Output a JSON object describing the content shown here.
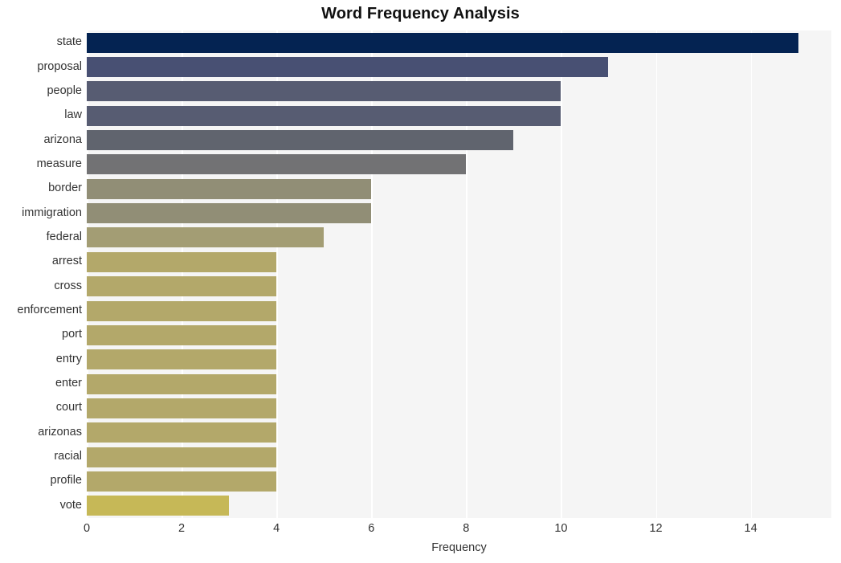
{
  "chart_data": {
    "type": "bar",
    "orientation": "horizontal",
    "title": "Word Frequency Analysis",
    "xlabel": "Frequency",
    "ylabel": "",
    "xlim": [
      0,
      15.7
    ],
    "ylim": null,
    "grid": true,
    "legend": null,
    "xticks": [
      "0",
      "2",
      "4",
      "6",
      "8",
      "10",
      "12",
      "14"
    ],
    "xtick_values": [
      0,
      2,
      4,
      6,
      8,
      10,
      12,
      14
    ],
    "categories": [
      "state",
      "proposal",
      "people",
      "law",
      "arizona",
      "measure",
      "border",
      "immigration",
      "federal",
      "arrest",
      "cross",
      "enforcement",
      "port",
      "entry",
      "enter",
      "court",
      "arizonas",
      "racial",
      "profile",
      "vote"
    ],
    "values": [
      15,
      11,
      10,
      10,
      9,
      8,
      6,
      6,
      5,
      4,
      4,
      4,
      4,
      4,
      4,
      4,
      4,
      4,
      4,
      3
    ],
    "bar_colors": [
      "#042352",
      "#485073",
      "#575c72",
      "#575c72",
      "#60646e",
      "#727274",
      "#918e76",
      "#918e76",
      "#a39d74",
      "#b3a86a",
      "#b3a86a",
      "#b3a86a",
      "#b3a86a",
      "#b3a86a",
      "#b3a86a",
      "#b3a86a",
      "#b3a86a",
      "#b3a86a",
      "#b3a86a",
      "#c6b857"
    ],
    "plot_background": "#f5f5f5",
    "gridline_color": "#ffffff",
    "text_color": "#333333",
    "title_color": "#111111"
  }
}
